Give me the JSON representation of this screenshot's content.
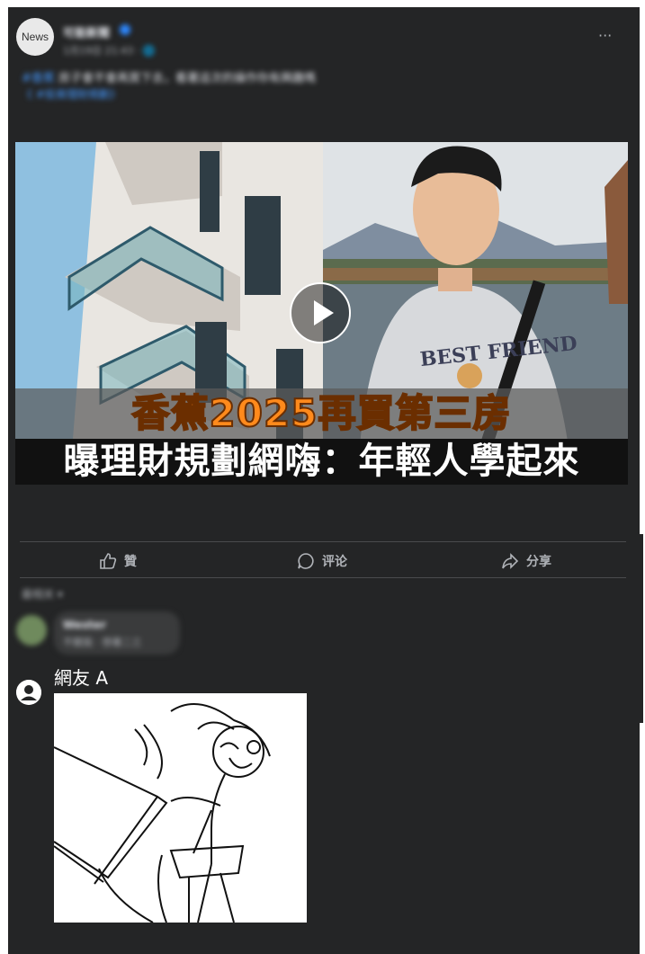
{
  "post": {
    "avatar_text": "News",
    "page_name": "可能新聞",
    "time": "1月19日 21:43 · 🌐",
    "caption_tag": "#香蕉",
    "caption_text": " 房子會不會再買下去，看著這次的操作你有興趣嗎",
    "caption_link": "《 #投資理財規劃》"
  },
  "video": {
    "headline_1": "香蕉2025再買第三房",
    "headline_2": "曝理財規劃網嗨：年輕人學起來",
    "shirt_text": "BEST FRIEND"
  },
  "actions": {
    "like": "贊",
    "comment": "评论",
    "share": "分享"
  },
  "comments": {
    "sort_label": "最相关 ▾",
    "first": {
      "name": "Wester",
      "text": "不關我 · 想著二三"
    },
    "second": {
      "name": "網友 A"
    }
  },
  "colors": {
    "background": "#242526",
    "accent": "#2d88ff",
    "headline": "#ff8a1c"
  }
}
